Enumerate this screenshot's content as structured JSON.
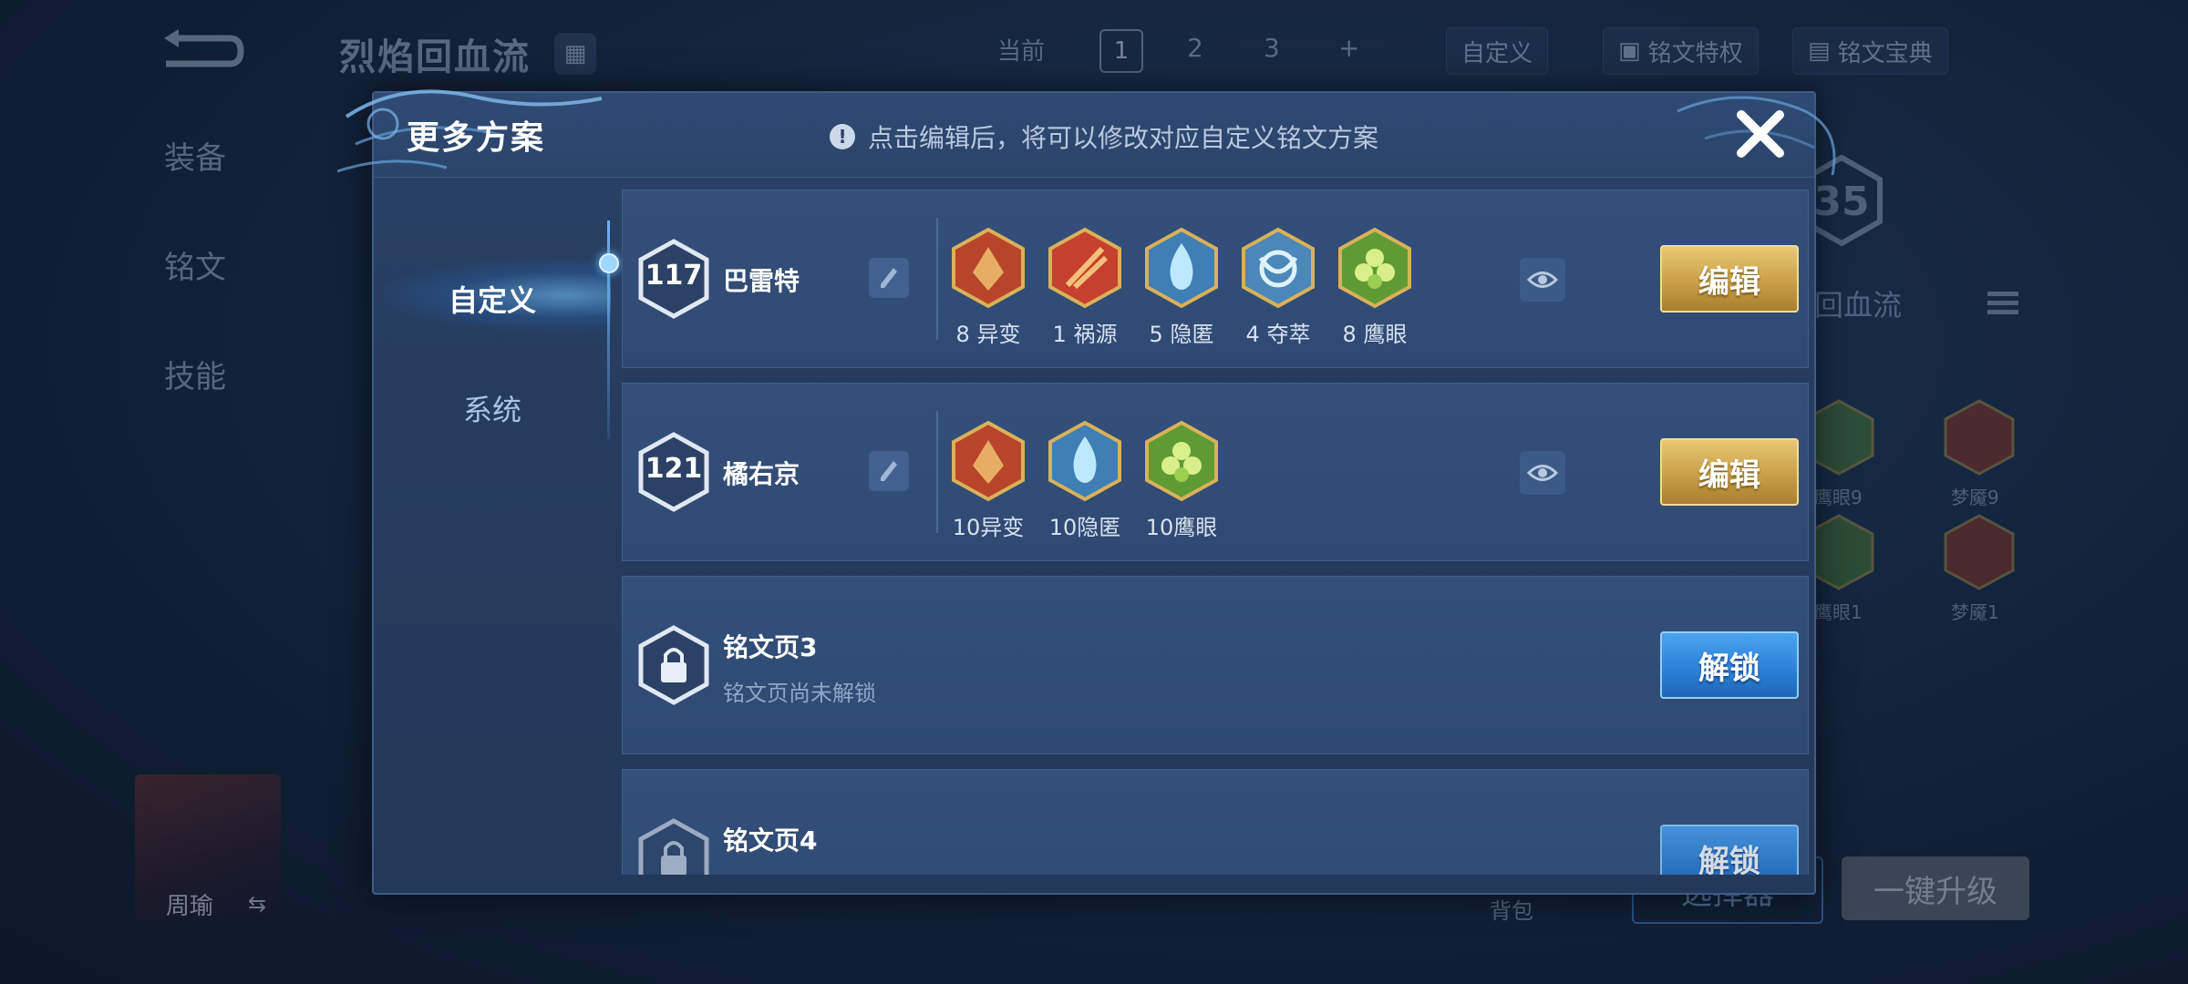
{
  "background": {
    "plan_title": "烈焰回血流",
    "left_tabs": [
      "装备",
      "铭文",
      "技能"
    ],
    "top_bar": {
      "current_label": "当前",
      "pages": [
        "1",
        "2",
        "3"
      ],
      "add_label": "+",
      "custom_label": "自定义",
      "privilege_label": "铭文特权",
      "codex_label": "铭文宝典"
    },
    "right_level": "35",
    "right_title": "回血流",
    "rune_labels": [
      "鹰眼9",
      "梦魇9",
      "鹰眼1",
      "梦魇1"
    ],
    "hero_name": "周瑜",
    "bag_label": "背包",
    "btn_select": "选择器",
    "btn_upgrade": "一键升级"
  },
  "modal": {
    "title": "更多方案",
    "hint": "点击编辑后，将可以修改对应自定义铭文方案",
    "tabs": [
      {
        "label": "自定义",
        "active": true
      },
      {
        "label": "系统",
        "active": false
      }
    ],
    "plans": [
      {
        "level": "117",
        "name": "巴雷特",
        "runes": [
          {
            "label": "8 异变",
            "color": "red",
            "icon": "red-crest-rune-icon"
          },
          {
            "label": "1 祸源",
            "color": "red",
            "icon": "red-feather-rune-icon"
          },
          {
            "label": "5 隐匿",
            "color": "blue",
            "icon": "blue-flame-rune-icon"
          },
          {
            "label": "4 夺萃",
            "color": "blue",
            "icon": "blue-knot-rune-icon"
          },
          {
            "label": "8 鹰眼",
            "color": "green",
            "icon": "green-clover-rune-icon"
          }
        ],
        "edit_label": "编辑"
      },
      {
        "level": "121",
        "name": "橘右京",
        "runes": [
          {
            "label": "10异变",
            "color": "red",
            "icon": "red-crest-rune-icon"
          },
          {
            "label": "10隐匿",
            "color": "blue",
            "icon": "blue-flame-rune-icon"
          },
          {
            "label": "10鹰眼",
            "color": "green",
            "icon": "green-clover-rune-icon"
          }
        ],
        "edit_label": "编辑"
      }
    ],
    "locked_pages": [
      {
        "title": "铭文页3",
        "subtitle": "铭文页尚未解锁",
        "unlock_label": "解锁"
      },
      {
        "title": "铭文页4",
        "subtitle": "",
        "unlock_label": "解锁"
      }
    ]
  },
  "colors": {
    "gold_button": "#c9a047",
    "blue_button": "#2b7fd6",
    "modal_bg": "#253c5e"
  }
}
